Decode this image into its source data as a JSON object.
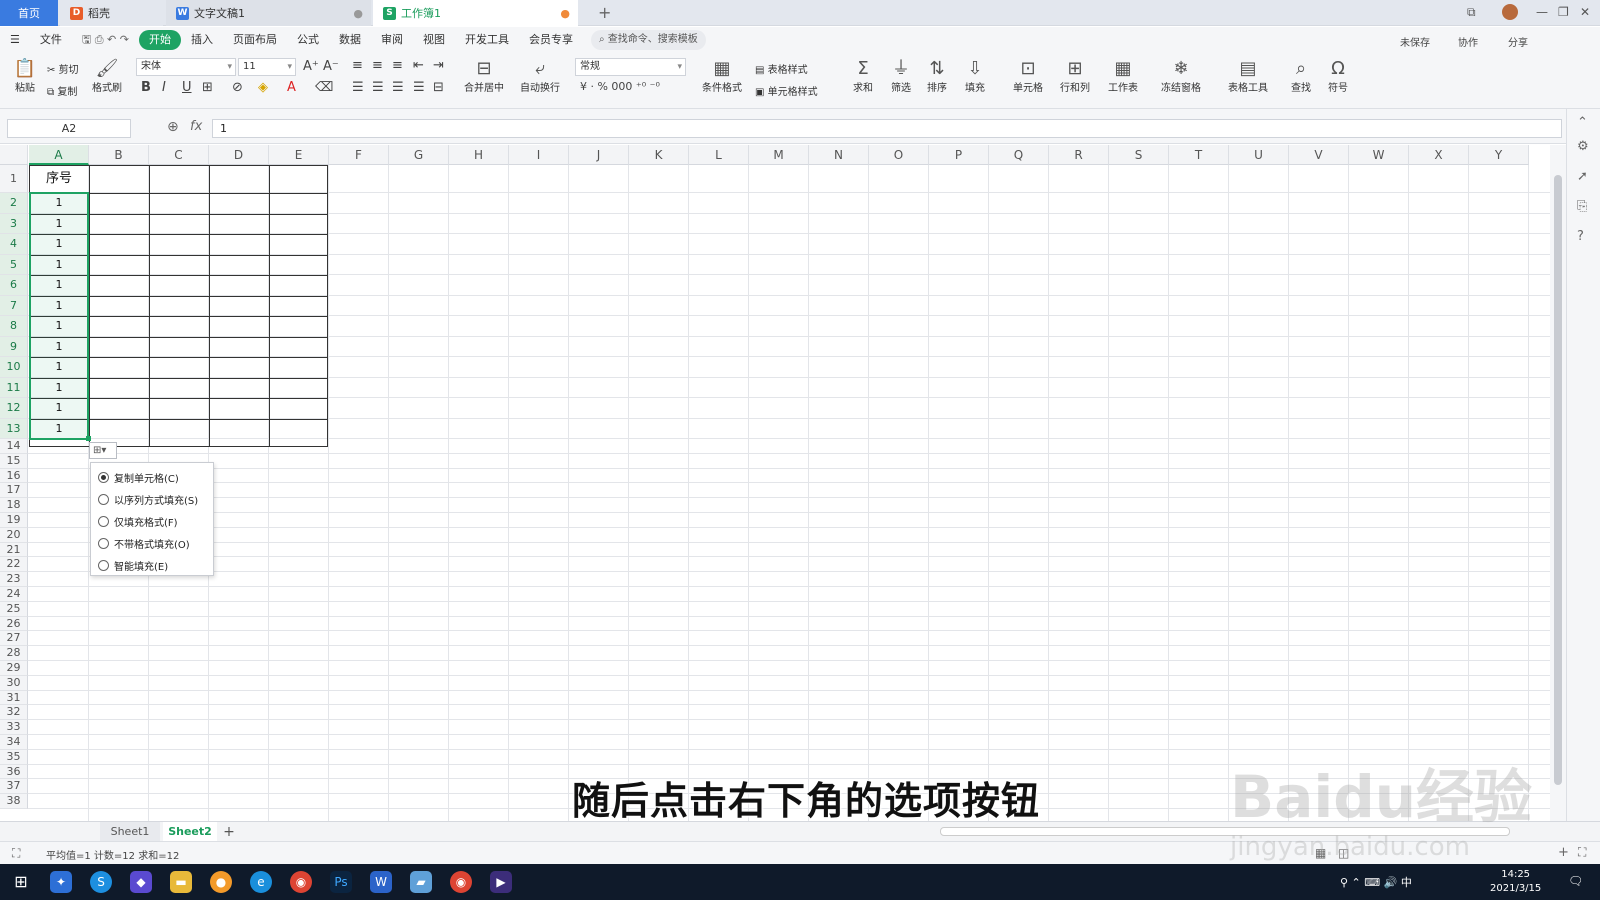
{
  "tabs": {
    "home": "首页",
    "docer": "稻壳",
    "doc": "文字文稿1",
    "book": "工作簿1"
  },
  "ribbon_tabs": [
    "文件",
    "开始",
    "插入",
    "页面布局",
    "公式",
    "数据",
    "审阅",
    "视图",
    "开发工具",
    "会员专享"
  ],
  "search_placeholder": "查找命令、搜索模板",
  "ribbon_right": {
    "unsaved": "未保存",
    "collab": "协作",
    "share": "分享"
  },
  "toolbar": {
    "paste": "粘贴",
    "cut": "剪切",
    "copy": "复制",
    "format_painter": "格式刷",
    "font": "宋体",
    "font_size": "11",
    "merge": "合并居中",
    "wrap": "自动换行",
    "number_format": "常规",
    "cond_format": "条件格式",
    "table_style": "表格样式",
    "cell_style": "单元格样式",
    "sum": "求和",
    "filter": "筛选",
    "sort": "排序",
    "fill": "填充",
    "cells": "单元格",
    "rowcol": "行和列",
    "sheet": "工作表",
    "freeze": "冻结窗格",
    "table_tools": "表格工具",
    "find": "查找",
    "symbol": "符号"
  },
  "formula_bar": {
    "name_box": "A2",
    "fx": "fx",
    "value": "1"
  },
  "columns": [
    "A",
    "B",
    "C",
    "D",
    "E",
    "F",
    "G",
    "H",
    "I",
    "J",
    "K",
    "L",
    "M",
    "N",
    "O",
    "P",
    "Q",
    "R",
    "S",
    "T",
    "U",
    "V",
    "W",
    "X",
    "Y"
  ],
  "rows": [
    "1",
    "2",
    "3",
    "4",
    "5",
    "6",
    "7",
    "8",
    "9",
    "10",
    "11",
    "12",
    "13",
    "14",
    "15",
    "16",
    "17",
    "18",
    "19",
    "20",
    "21",
    "22",
    "23",
    "24",
    "25",
    "26",
    "27",
    "28",
    "29",
    "30",
    "31",
    "32",
    "33",
    "34",
    "35",
    "36",
    "37",
    "38"
  ],
  "cells": {
    "A1": "序号",
    "A_values": [
      "1",
      "1",
      "1",
      "1",
      "1",
      "1",
      "1",
      "1",
      "1",
      "1",
      "1",
      "1"
    ]
  },
  "autofill_menu": {
    "options": [
      "复制单元格(C)",
      "以序列方式填充(S)",
      "仅填充格式(F)",
      "不带格式填充(O)",
      "智能填充(E)"
    ],
    "selected_index": 0
  },
  "sheets": [
    "Sheet1",
    "Sheet2"
  ],
  "active_sheet": "Sheet2",
  "status": "平均值=1  计数=12  求和=12",
  "caption": "随后点击右下角的选项按钮",
  "clock": {
    "time": "14:25",
    "date": "2021/3/15"
  },
  "watermark": "Baidu经验",
  "watermark_url": "jingyan.baidu.com",
  "colors": {
    "accent": "#1ea363",
    "tab_home": "#3a7be0"
  }
}
